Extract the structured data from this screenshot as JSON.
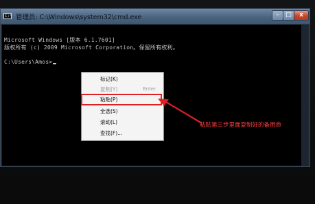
{
  "window": {
    "title": "管理员: C:\\Windows\\system32\\cmd.exe",
    "icon_label": "C:\\",
    "controls": {
      "minimize": "–",
      "maximize": "□",
      "close": "x"
    }
  },
  "console": {
    "line1": "Microsoft Windows [版本 6.1.7601]",
    "line2": "版权所有 (c) 2009 Microsoft Corporation。保留所有权利。",
    "prompt": "C:\\Users\\Amos>"
  },
  "context_menu": {
    "items": [
      {
        "label": "标记(K)",
        "shortcut": "",
        "disabled": false
      },
      {
        "label": "复制(Y)",
        "shortcut": "Enter",
        "disabled": true
      },
      {
        "label": "粘贴(P)",
        "shortcut": "",
        "disabled": false
      },
      {
        "label": "全选(S)",
        "shortcut": "",
        "disabled": false
      },
      {
        "label": "滚动(L)",
        "shortcut": "",
        "disabled": false
      },
      {
        "label": "查找(F)...",
        "shortcut": "",
        "disabled": false
      }
    ]
  },
  "annotation": {
    "text": "粘贴第三步里面复制好的备用命",
    "color": "#ff3b3b"
  },
  "icons": {
    "cmd": "cmd-window-icon",
    "arrow": "annotation-arrow-icon"
  }
}
